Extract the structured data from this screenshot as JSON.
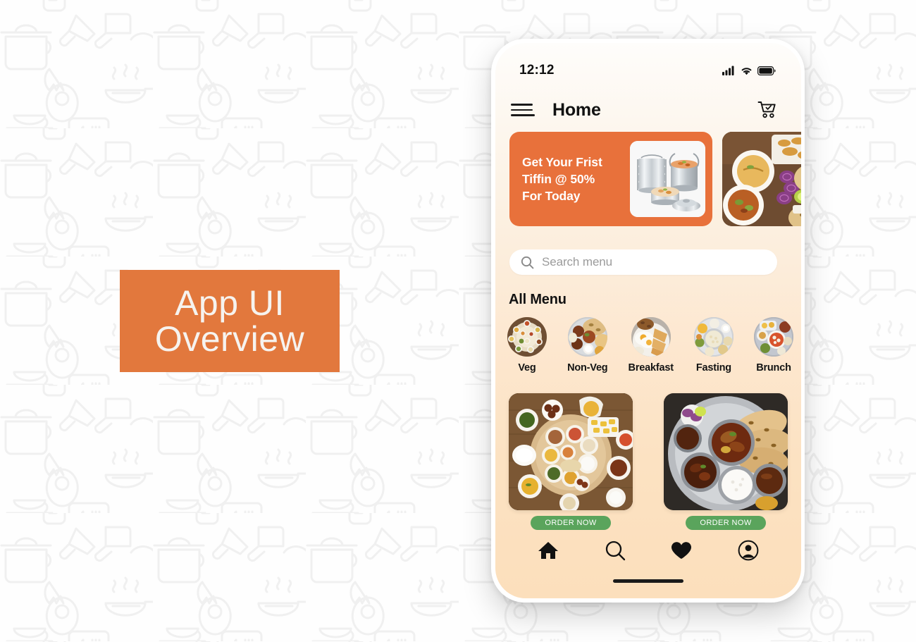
{
  "poster": {
    "overview_label_line1": "App UI",
    "overview_label_line2": "Overview",
    "accent_color": "#e2783d",
    "background_color": "#fdfdfd"
  },
  "phone": {
    "status_bar": {
      "time": "12:12",
      "signal_icon": "cellular-signal-icon",
      "wifi_icon": "wifi-icon",
      "battery_icon": "battery-full-icon"
    },
    "app_bar": {
      "menu_icon": "hamburger-menu-icon",
      "title": "Home",
      "cart_icon": "shopping-cart-icon"
    },
    "promo": {
      "headline_line1": "Get Your Frist",
      "headline_line2": "Tiffin @ 50%",
      "headline_line3": "For Today",
      "banner_color": "#e8713b",
      "product_image": "stainless-steel-tiffin-carrier",
      "secondary_banner_image": "indian-thali-photo"
    },
    "search": {
      "icon": "search-icon",
      "placeholder": "Search menu",
      "value": ""
    },
    "menu_section": {
      "title": "All Menu",
      "categories": [
        {
          "label": "Veg",
          "image": "veg-thali-photo"
        },
        {
          "label": "Non-Veg",
          "image": "non-veg-thali-photo"
        },
        {
          "label": "Breakfast",
          "image": "breakfast-plate-photo"
        },
        {
          "label": "Fasting",
          "image": "fasting-thali-photo"
        },
        {
          "label": "Brunch",
          "image": "brunch-plate-photo"
        }
      ]
    },
    "dishes": [
      {
        "image": "full-indian-thali-spread-photo",
        "order_label": "ORDER NOW"
      },
      {
        "image": "steel-thali-with-roti-photo",
        "order_label": "ORDER NOW"
      }
    ],
    "order_button_color": "#5aa45c",
    "bottom_nav": [
      {
        "icon": "home-icon",
        "active": true
      },
      {
        "icon": "search-icon",
        "active": false
      },
      {
        "icon": "heart-icon",
        "active": false
      },
      {
        "icon": "profile-account-icon",
        "active": false
      }
    ],
    "home_indicator": "home-indicator-bar"
  }
}
